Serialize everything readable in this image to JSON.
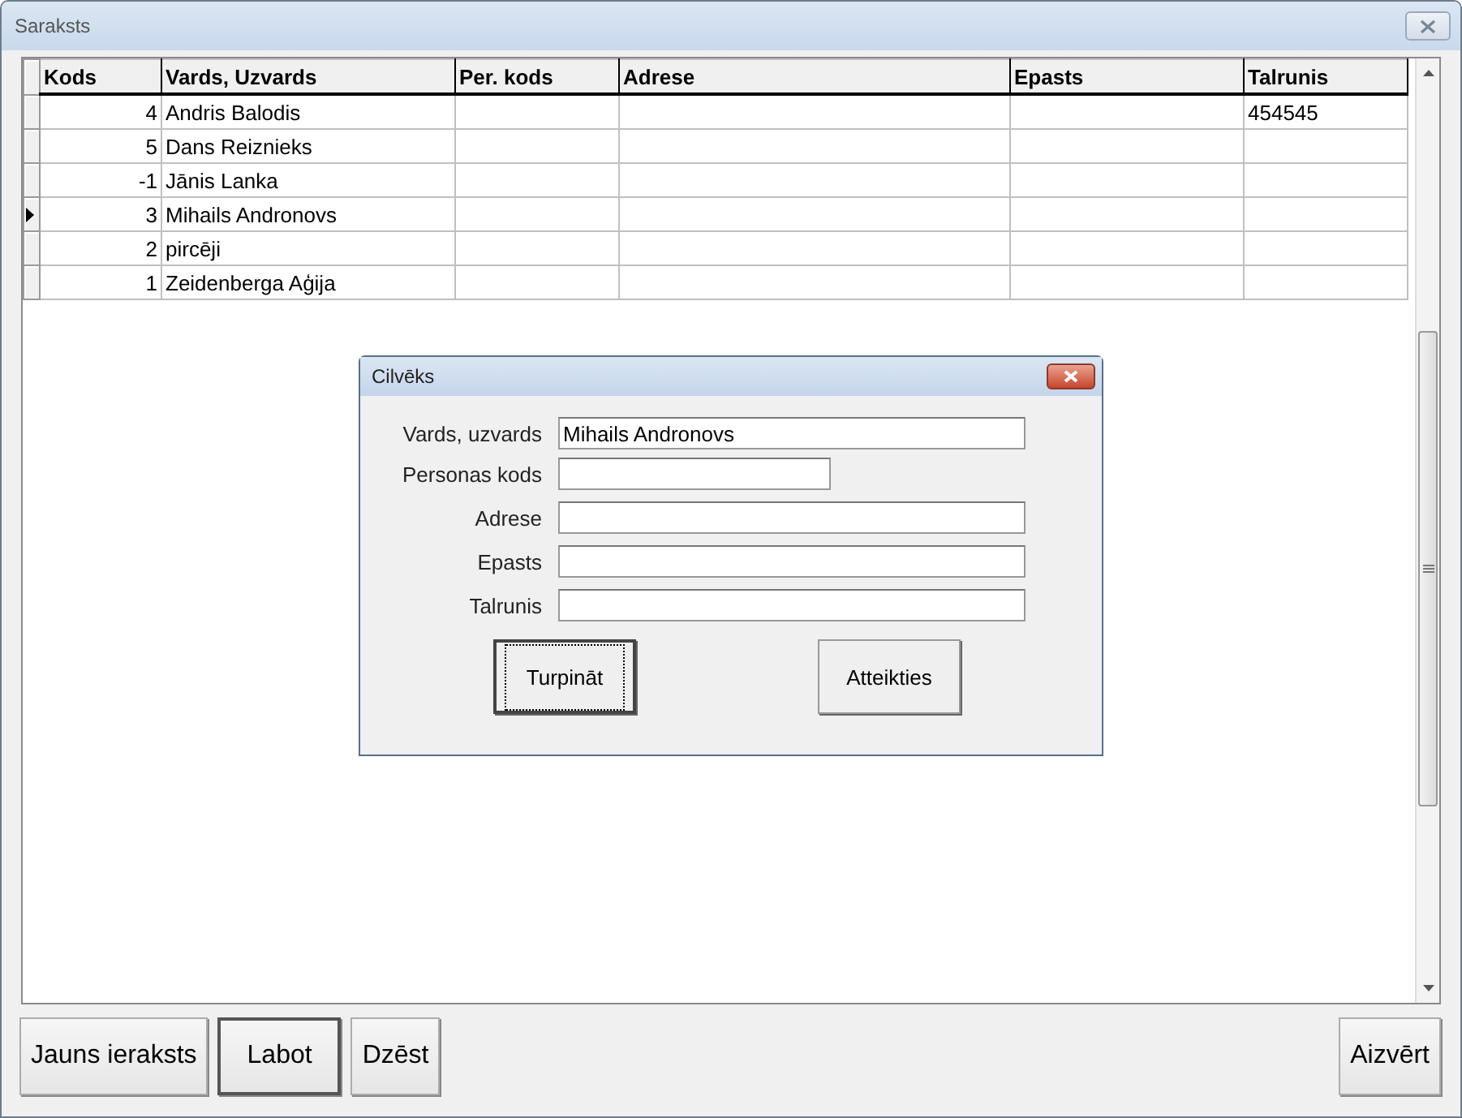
{
  "window": {
    "title": "Saraksts"
  },
  "table": {
    "columns": [
      "Kods",
      "Vards, Uzvards",
      "Per. kods",
      "Adrese",
      "Epasts",
      "Talrunis"
    ],
    "rows": [
      {
        "selected": false,
        "cells": [
          "4",
          "Andris Balodis",
          "",
          "",
          "",
          "454545"
        ]
      },
      {
        "selected": false,
        "cells": [
          "5",
          "Dans Reiznieks",
          "",
          "",
          "",
          ""
        ]
      },
      {
        "selected": false,
        "cells": [
          "-1",
          "Jānis Lanka",
          "",
          "",
          "",
          ""
        ]
      },
      {
        "selected": true,
        "cells": [
          "3",
          "Mihails Andronovs",
          "",
          "",
          "",
          ""
        ]
      },
      {
        "selected": false,
        "cells": [
          "2",
          "pircēji",
          "",
          "",
          "",
          ""
        ]
      },
      {
        "selected": false,
        "cells": [
          "1",
          "Zeidenberga Aģija",
          "",
          "",
          "",
          ""
        ]
      }
    ]
  },
  "buttons": [
    {
      "label": "Jauns ieraksts",
      "default": false
    },
    {
      "label": "Labot",
      "default": true
    },
    {
      "label": "Dzēst",
      "default": false
    },
    {
      "label": "Aizvērt",
      "default": false
    }
  ],
  "dialog": {
    "title": "Cilvēks",
    "fields": [
      {
        "label": "Vards, uzvards",
        "value": "Mihails Andronovs",
        "kind": "wide"
      },
      {
        "label": "Personas kods",
        "kind": "short"
      },
      {
        "label": "Adrese",
        "kind": "wide"
      },
      {
        "label": "Epasts",
        "kind": "wide"
      },
      {
        "label": "Talrunis",
        "kind": "wide"
      }
    ],
    "buttons": [
      {
        "label": "Turpināt",
        "focused": true
      },
      {
        "label": "Atteikties",
        "focused": false
      }
    ]
  }
}
